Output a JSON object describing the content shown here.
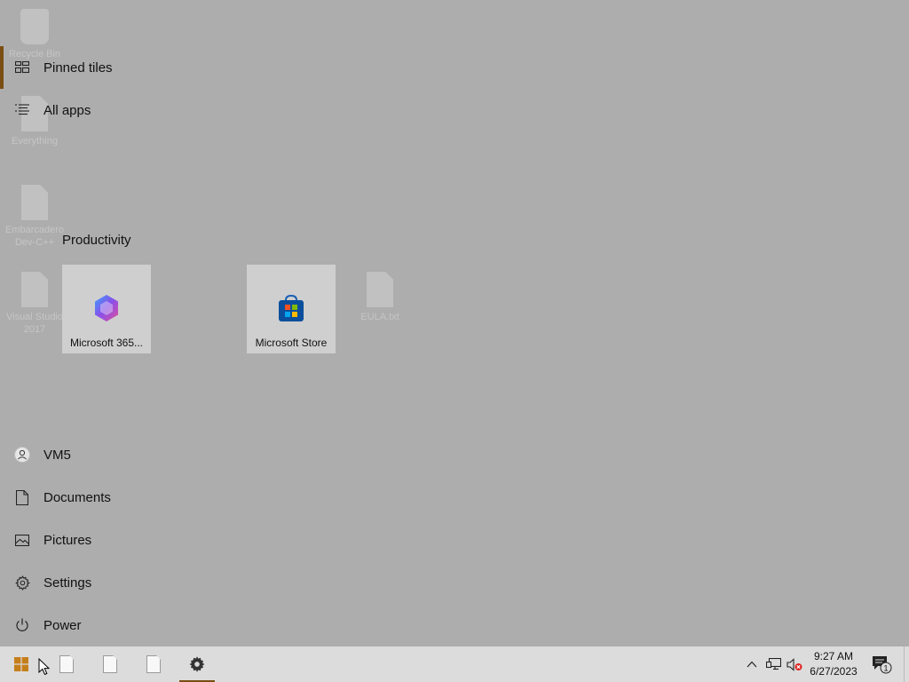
{
  "desktop": {
    "icons": [
      {
        "label": "Recycle Bin",
        "icon": "recycle-bin-icon"
      },
      {
        "label": "Everything",
        "icon": "file-icon"
      },
      {
        "label": "Embarcadero Dev-C++",
        "icon": "file-icon"
      },
      {
        "label": "Visual Studio 2017",
        "icon": "file-icon"
      },
      {
        "label": "EULA.txt",
        "icon": "file-icon"
      }
    ]
  },
  "start_menu": {
    "top_items": [
      {
        "label": "Pinned tiles",
        "icon": "tiles-icon",
        "selected": true
      },
      {
        "label": "All apps",
        "icon": "list-icon"
      }
    ],
    "group_title": "Productivity",
    "tiles": [
      {
        "label": "Microsoft 365...",
        "icon": "microsoft-365-icon"
      },
      {
        "label": "Microsoft Store",
        "icon": "microsoft-store-icon"
      }
    ],
    "bottom_items": [
      {
        "label": "VM5",
        "icon": "user-icon"
      },
      {
        "label": "Documents",
        "icon": "document-icon"
      },
      {
        "label": "Pictures",
        "icon": "pictures-icon"
      },
      {
        "label": "Settings",
        "icon": "gear-icon"
      },
      {
        "label": "Power",
        "icon": "power-icon"
      }
    ]
  },
  "taskbar": {
    "time": "9:27 AM",
    "date": "6/27/2023",
    "notification_count": "1",
    "accent_color": "#7a4e12"
  }
}
